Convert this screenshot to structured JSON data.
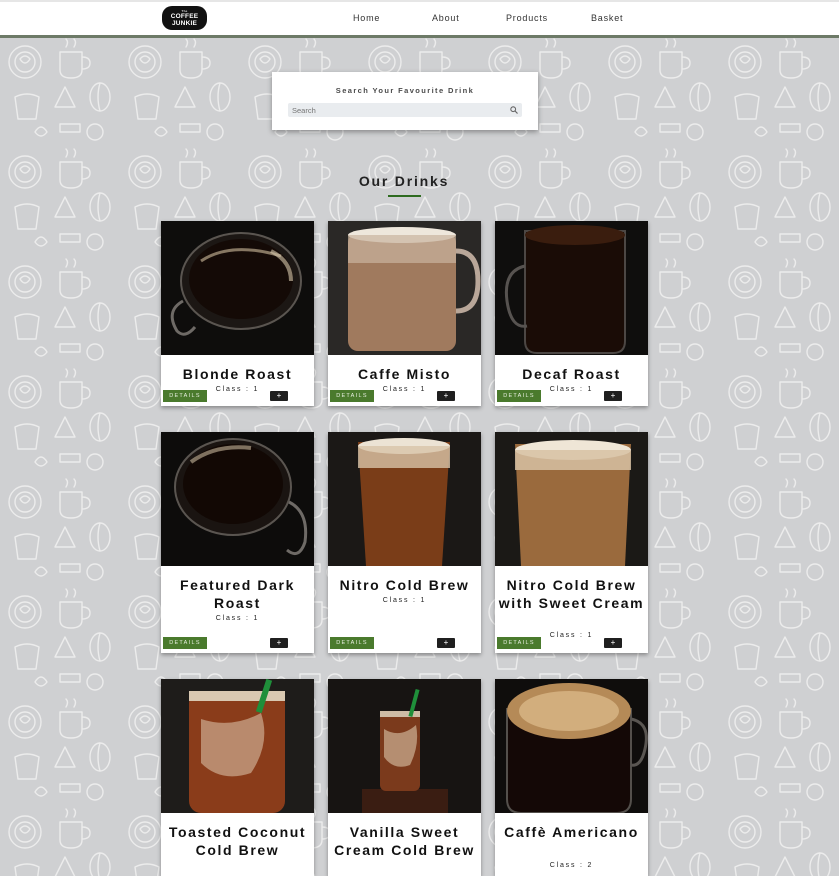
{
  "brand": {
    "logo_line1": "The",
    "logo_line2": "COFFEE",
    "logo_line3": "JUNKIE"
  },
  "nav": {
    "home": "Home",
    "about": "About",
    "products": "Products",
    "basket": "Basket"
  },
  "search": {
    "title": "Search Your Favourite Drink",
    "placeholder": "Search"
  },
  "section": {
    "title": "Our Drinks"
  },
  "buttons": {
    "details": "DETAILS",
    "add": "+"
  },
  "drinks": [
    {
      "name": "Blonde Roast",
      "class": "Class : 1"
    },
    {
      "name": "Caffe Misto",
      "class": "Class : 1"
    },
    {
      "name": "Decaf Roast",
      "class": "Class : 1"
    },
    {
      "name": "Featured Dark Roast",
      "class": "Class : 1"
    },
    {
      "name": "Nitro Cold Brew",
      "class": "Class : 1"
    },
    {
      "name": "Nitro Cold Brew with Sweet Cream",
      "class": "Class : 1"
    },
    {
      "name": "Toasted Coconut Cold Brew",
      "class": ""
    },
    {
      "name": "Vanilla Sweet Cream Cold Brew",
      "class": ""
    },
    {
      "name": "Caffè Americano",
      "class": "Class : 2"
    }
  ],
  "colors": {
    "accent": "#4a7a2d",
    "nav_border": "#6d7a67",
    "background": "#cfd0d2"
  },
  "icons": {
    "search": "search-icon",
    "logo": "coffee-junkie-logo"
  }
}
